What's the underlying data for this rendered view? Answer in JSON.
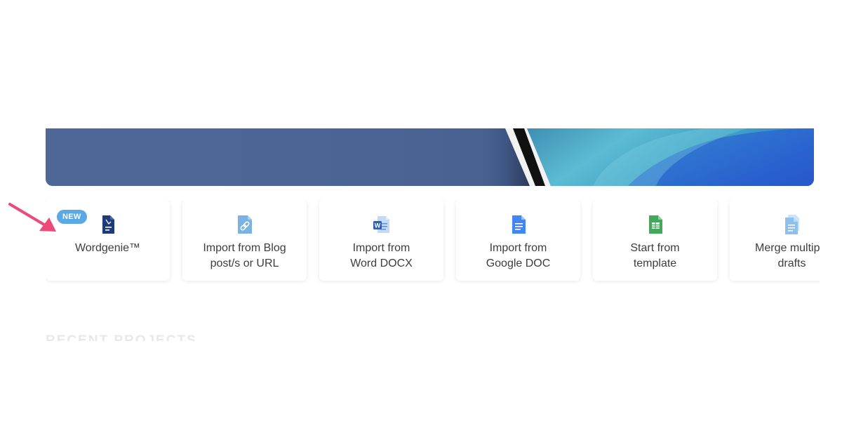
{
  "colors": {
    "banner_left": "#4d6797",
    "banner_right": "#2f5bd1",
    "badge": "#59a9e6",
    "arrow": "#ec4a78",
    "card_text": "#3d3d3d"
  },
  "cards": [
    {
      "label": "Wordgenie™",
      "icon": "wordgenie-doc-icon",
      "badge": "NEW"
    },
    {
      "label": "Import from Blog\npost/s or URL",
      "icon": "link-doc-icon"
    },
    {
      "label": "Import from\nWord DOCX",
      "icon": "word-docx-icon"
    },
    {
      "label": "Import from\nGoogle DOC",
      "icon": "google-doc-icon"
    },
    {
      "label": "Start from\ntemplate",
      "icon": "template-sheet-icon"
    },
    {
      "label": "Merge multiple\ndrafts",
      "icon": "merge-docs-icon"
    }
  ],
  "recent": {
    "heading": "RECENT PROJECTS"
  }
}
